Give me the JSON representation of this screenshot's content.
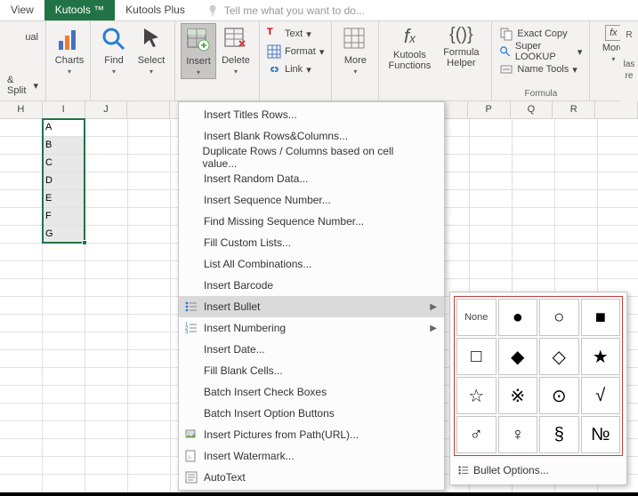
{
  "tabs": {
    "view": "View",
    "kutools": "Kutools ™",
    "kutoolsPlus": "Kutools Plus",
    "tellme": "Tell me what you want to do..."
  },
  "ribbon": {
    "viewGroup": {
      "ual": "ual",
      "split": "& Split"
    },
    "charts": "Charts",
    "find": "Find",
    "select": "Select",
    "insert": "Insert",
    "delete": "Delete",
    "text": "Text",
    "format": "Format",
    "link": "Link",
    "more": "More",
    "kutoolsFunctions": "Kutools\nFunctions",
    "formulaHelper": "Formula\nHelper",
    "exactCopy": "Exact Copy",
    "superLookup": "Super LOOKUP",
    "nameTools": "Name Tools",
    "more2": "More",
    "r": "R",
    "las": "las",
    "re": "re",
    "formulaLabel": "Formula"
  },
  "menu": {
    "items": [
      "Insert Titles Rows...",
      "Insert Blank Rows&Columns...",
      "Duplicate Rows / Columns based on cell value...",
      "Insert Random Data...",
      "Insert Sequence Number...",
      "Find Missing Sequence Number...",
      "Fill Custom Lists...",
      "List All Combinations...",
      "Insert Barcode",
      "Insert Bullet",
      "Insert Numbering",
      "Insert Date...",
      "Fill Blank Cells...",
      "Batch Insert Check Boxes",
      "Batch Insert Option Buttons",
      "Insert Pictures from Path(URL)...",
      "Insert Watermark...",
      "AutoText"
    ]
  },
  "bullet": {
    "none": "None",
    "options": "Bullet Options...",
    "glyphs": [
      "●",
      "○",
      "■",
      "□",
      "◆",
      "◇",
      "★",
      "☆",
      "※",
      "⊙",
      "√",
      "♂",
      "♀",
      "§",
      "№"
    ]
  },
  "grid": {
    "cols": [
      "H",
      "I",
      "J",
      "",
      "",
      "",
      "",
      "",
      "",
      "",
      "",
      "P",
      "Q",
      "R",
      ""
    ],
    "data": [
      "A",
      "B",
      "C",
      "D",
      "E",
      "F",
      "G"
    ]
  }
}
